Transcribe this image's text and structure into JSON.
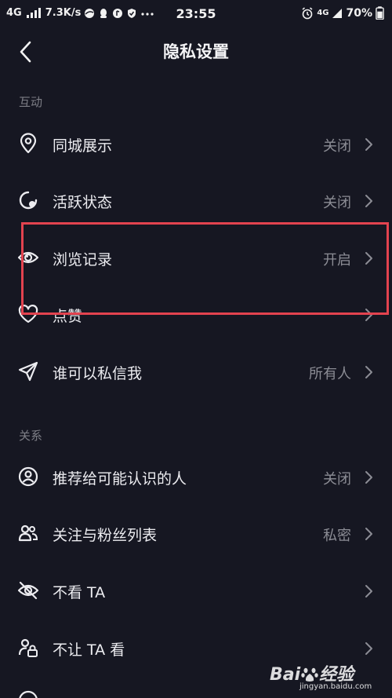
{
  "status_bar": {
    "network": "4G",
    "speed": "7.3K/s",
    "time": "23:55",
    "network_right": "4G",
    "battery": "70%"
  },
  "header": {
    "title": "隐私设置"
  },
  "sections": [
    {
      "label": "互动",
      "items": [
        {
          "label": "同城展示",
          "value": "关闭",
          "icon": "location-pin-icon"
        },
        {
          "label": "活跃状态",
          "value": "关闭",
          "icon": "activity-status-icon"
        },
        {
          "label": "浏览记录",
          "value": "开启",
          "icon": "eye-icon"
        },
        {
          "label": "点赞",
          "value": "",
          "icon": "heart-icon"
        },
        {
          "label": "谁可以私信我",
          "value": "所有人",
          "icon": "send-message-icon"
        }
      ]
    },
    {
      "label": "关系",
      "items": [
        {
          "label": "推荐给可能认识的人",
          "value": "关闭",
          "icon": "person-circle-icon"
        },
        {
          "label": "关注与粉丝列表",
          "value": "私密",
          "icon": "users-icon"
        },
        {
          "label": "不看 TA",
          "value": "",
          "icon": "eye-off-icon"
        },
        {
          "label": "不让 TA 看",
          "value": "",
          "icon": "user-lock-icon"
        }
      ]
    }
  ],
  "watermark": {
    "brand": "Bai",
    "brand_end": "经验",
    "url": "jingyan.baidu.com"
  },
  "colors": {
    "background": "#161722",
    "highlight": "#e3434f",
    "muted_text": "#8c8d95"
  }
}
